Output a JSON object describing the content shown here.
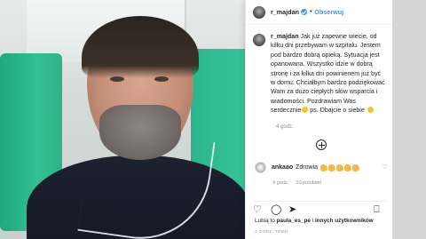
{
  "post": {
    "username": "r_majdan",
    "follow_label": "Obserwuj",
    "separator": "•"
  },
  "caption": {
    "username": "r_majdan",
    "text": "Jak już zapewne wiecie, od kilku dni przebywam w szpitalu. Jestem pod bardzo dobrą opieką. Sytuacja jest opanowana. Wszystko idzie w dobrą stronę i za kilka dni powinienem już być w domu. Chciałbym bardzo podziękować Wam za dużo ciepłych słów wsparcia i wiadomości. Pozdrawiam Was serdecznie",
    "tail": " ps. Dbajcie o siebie",
    "time": "4 godz."
  },
  "comment": {
    "username": "ankaao",
    "text": "Zdrowia",
    "time": "4 godz.",
    "likes": "10 polubień"
  },
  "likes_line": {
    "prefix": "Lubią to ",
    "user": "paula_es_pe",
    "suffix": " i ",
    "others": "innych użytkowników"
  },
  "date": "4 GODZ. TEMU",
  "icons": {
    "heart": "♡",
    "comment": "◯",
    "share": "➤",
    "bookmark": "⎕",
    "small_heart": "♡"
  }
}
